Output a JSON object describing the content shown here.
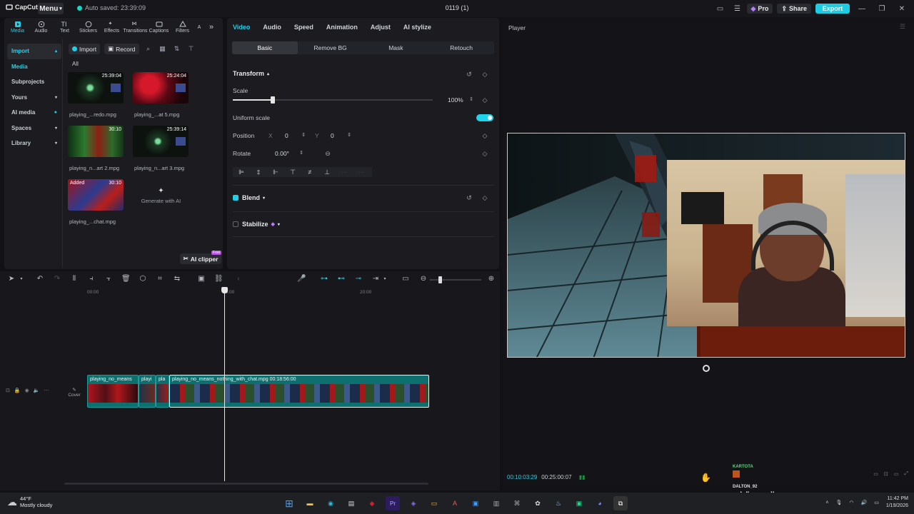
{
  "titlebar": {
    "app_name": "CapCut",
    "menu_label": "Menu",
    "autosave_text": "Auto saved: 23:39:09",
    "project_title": "0119 (1)",
    "pro_label": "Pro",
    "share_label": "Share",
    "export_label": "Export"
  },
  "media_tools": [
    {
      "label": "Media",
      "icon": "media-icon"
    },
    {
      "label": "Audio",
      "icon": "audio-icon"
    },
    {
      "label": "Text",
      "icon": "text-icon"
    },
    {
      "label": "Stickers",
      "icon": "stickers-icon"
    },
    {
      "label": "Effects",
      "icon": "effects-icon"
    },
    {
      "label": "Transitions",
      "icon": "transitions-icon"
    },
    {
      "label": "Captions",
      "icon": "captions-icon"
    },
    {
      "label": "Filters",
      "icon": "filters-icon"
    },
    {
      "label": "A",
      "icon": "more-icon"
    }
  ],
  "left_nav": [
    {
      "label": "Import"
    },
    {
      "label": "Media"
    },
    {
      "label": "Subprojects"
    },
    {
      "label": "Yours"
    },
    {
      "label": "AI media"
    },
    {
      "label": "Spaces"
    },
    {
      "label": "Library"
    }
  ],
  "media_bar": {
    "import_label": "Import",
    "record_label": "Record",
    "all_label": "All"
  },
  "media_items": [
    {
      "name": "playing_...redo.mpg",
      "duration": "25:39:04"
    },
    {
      "name": "playing_...at 5.mpg",
      "duration": "25:24:04"
    },
    {
      "name": "playing_n...art 2.mpg",
      "duration": "30:10"
    },
    {
      "name": "playing_n...art 3.mpg",
      "duration": "25:39:14"
    },
    {
      "name": "playing_...chat.mpg",
      "duration": "30:10",
      "badge": "Added"
    }
  ],
  "generate_ai_label": "Generate with AI",
  "ai_clipper": {
    "label": "AI clipper",
    "badge": "Free"
  },
  "props": {
    "tabs": [
      "Video",
      "Audio",
      "Speed",
      "Animation",
      "Adjust",
      "AI stylize"
    ],
    "subtabs": [
      "Basic",
      "Remove BG",
      "Mask",
      "Retouch"
    ],
    "transform_title": "Transform",
    "scale_label": "Scale",
    "scale_value": "100%",
    "scale_fraction": 0.2,
    "uniform_label": "Uniform scale",
    "position_label": "Position",
    "pos_x_label": "X",
    "pos_x": "0",
    "pos_y_label": "Y",
    "pos_y": "0",
    "rotate_label": "Rotate",
    "rotate_value": "0.00°",
    "blend_title": "Blend",
    "stabilize_title": "Stabilize"
  },
  "player": {
    "title": "Player",
    "current_time": "00:10:03:29",
    "total_time": "00:25:00:07"
  },
  "timeline": {
    "ruler_labels": [
      "00:00",
      "10:00",
      "20:00"
    ],
    "cover_label": "Cover",
    "clips": [
      {
        "label": "playing_no_means"
      },
      {
        "label": "playi"
      },
      {
        "label": "pla"
      },
      {
        "label": "playing_no_means_nothing_with_chat.mpg  00:18:56:00"
      }
    ]
  },
  "chat_overlay": {
    "user1": "KARTOTA",
    "user2": "DALTON_92",
    "message": "nah I'm good!"
  },
  "taskbar": {
    "temp": "44°F",
    "weather": "Mostly cloudy",
    "time": "11:42 PM",
    "date": "1/19/2026"
  },
  "colors": {
    "accent": "#21d0e8",
    "clip": "#0e6f6f"
  }
}
